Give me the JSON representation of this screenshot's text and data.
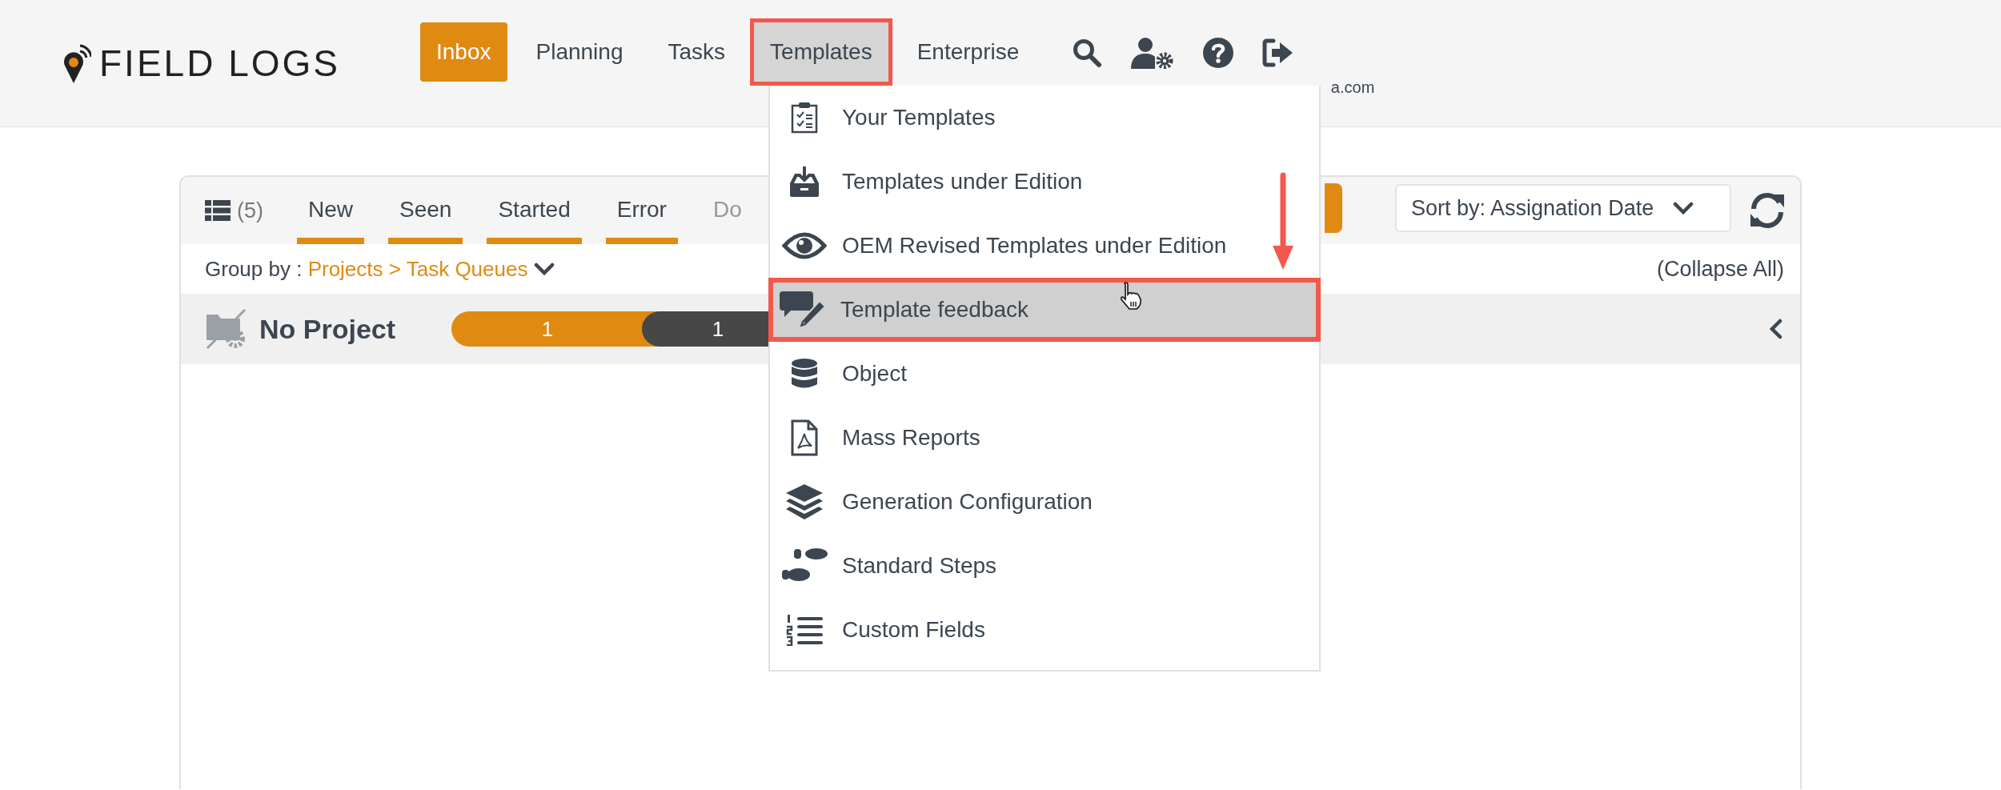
{
  "header": {
    "logo": "FIELD LOGS",
    "nav": [
      {
        "label": "Inbox",
        "selected": true,
        "open": false,
        "highlighted": false
      },
      {
        "label": "Planning",
        "selected": false,
        "open": false,
        "highlighted": false
      },
      {
        "label": "Tasks",
        "selected": false,
        "open": false,
        "highlighted": false
      },
      {
        "label": "Templates",
        "selected": false,
        "open": true,
        "highlighted": true
      },
      {
        "label": "Enterprise",
        "selected": false,
        "open": false,
        "highlighted": false
      }
    ],
    "user_email": "a.com"
  },
  "templates_menu": {
    "items": [
      {
        "kind": "clipboard",
        "label": "Your Templates",
        "hovered": false,
        "highlighted": false
      },
      {
        "kind": "inbox",
        "label": "Templates under Edition",
        "hovered": false,
        "highlighted": false
      },
      {
        "kind": "eye",
        "label": "OEM Revised Templates under Edition",
        "hovered": false,
        "highlighted": false
      },
      {
        "kind": "feedback",
        "label": "Template feedback",
        "hovered": true,
        "highlighted": true
      },
      {
        "kind": "database",
        "label": "Object",
        "hovered": false,
        "highlighted": false
      },
      {
        "kind": "pdf",
        "label": "Mass Reports",
        "hovered": false,
        "highlighted": false
      },
      {
        "kind": "layers",
        "label": "Generation Configuration",
        "hovered": false,
        "highlighted": false
      },
      {
        "kind": "steps",
        "label": "Standard Steps",
        "hovered": false,
        "highlighted": false
      },
      {
        "kind": "numbered",
        "label": "Custom Fields",
        "hovered": false,
        "highlighted": false
      }
    ]
  },
  "panel": {
    "count": "(5)",
    "tabs": [
      {
        "label": "New",
        "underlined": true,
        "dimmed": false
      },
      {
        "label": "Seen",
        "underlined": true,
        "dimmed": false
      },
      {
        "label": "Started",
        "underlined": true,
        "dimmed": false
      },
      {
        "label": "Error",
        "underlined": true,
        "dimmed": false
      },
      {
        "label": "Do",
        "underlined": false,
        "dimmed": true
      }
    ],
    "sort": "Sort by: Assignation Date",
    "group_by_label": "Group by :",
    "group_by_value": "Projects > Task Queues",
    "collapse_all": "(Collapse All)",
    "group": {
      "name": "No Project",
      "counts": [
        {
          "value": "1",
          "color": "#e08a12"
        },
        {
          "value": "1",
          "color": "#474747"
        }
      ]
    }
  }
}
